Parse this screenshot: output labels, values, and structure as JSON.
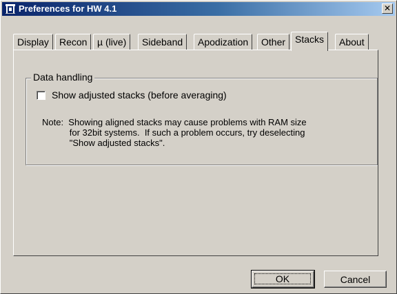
{
  "window": {
    "title": "Preferences for HW 4.1",
    "icon": "hw-app-icon",
    "close_label": "x"
  },
  "tabs": [
    {
      "label": "Display",
      "active": false
    },
    {
      "label": "Recon",
      "active": false
    },
    {
      "label": "µ (live)",
      "active": false
    },
    {
      "label": "Sideband",
      "active": false
    },
    {
      "label": "Apodization",
      "active": false
    },
    {
      "label": "Other",
      "active": false
    },
    {
      "label": "Stacks",
      "active": true
    },
    {
      "label": "About",
      "active": false
    }
  ],
  "stacks": {
    "group_title": "Data handling",
    "checkbox_label": "Show adjusted stacks (before averaging)",
    "checkbox_checked": false,
    "note_lines": [
      "Note:  Showing aligned stacks may cause problems with RAM size",
      "           for 32bit systems.  If such a problem occurs, try deselecting",
      "           \"Show adjusted stacks\"."
    ]
  },
  "buttons": {
    "ok": "OK",
    "cancel": "Cancel"
  }
}
